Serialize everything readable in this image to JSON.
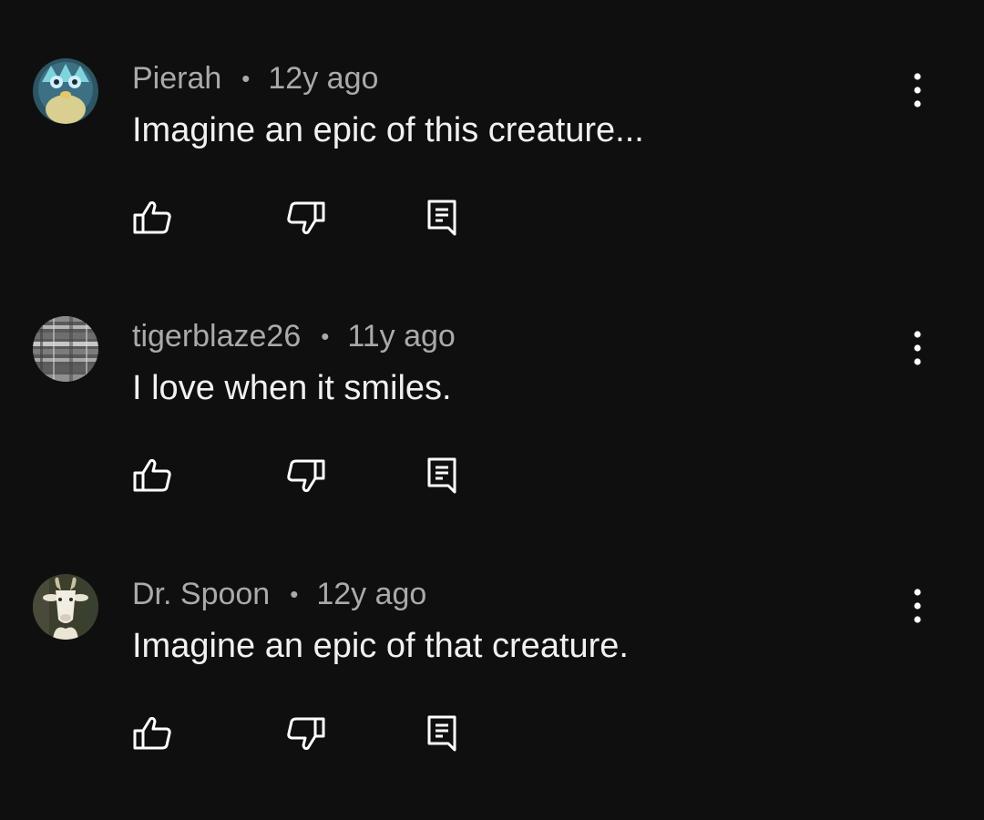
{
  "comments": [
    {
      "author": "Pierah",
      "separator": "•",
      "time": "12y ago",
      "text": "Imagine an epic of this creature...",
      "avatar_icon": "teal-creature-avatar"
    },
    {
      "author": "tigerblaze26",
      "separator": "•",
      "time": "11y ago",
      "text": "I love when it smiles.",
      "avatar_icon": "gray-striped-avatar"
    },
    {
      "author": "Dr. Spoon",
      "separator": "•",
      "time": "12y ago",
      "text": "Imagine an epic of that creature.",
      "avatar_icon": "goat-avatar"
    }
  ],
  "icons": {
    "like": "thumbs-up-icon",
    "dislike": "thumbs-down-icon",
    "reply": "reply-icon",
    "more": "more-vertical-icon"
  },
  "colors": {
    "background": "#0f0f0f",
    "meta_text": "#aaaaaa",
    "body_text": "#f1f1f1",
    "icon": "#ffffff"
  }
}
